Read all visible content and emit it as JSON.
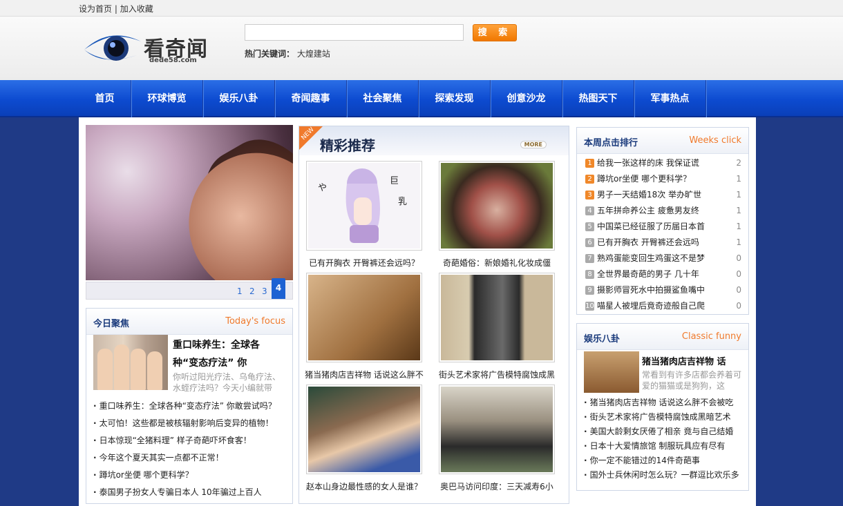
{
  "topbar": {
    "set_home": "设为首页",
    "separator": "|",
    "add_fav": "加入收藏"
  },
  "logo": {
    "brand": "看奇闻",
    "domain": "dede58.com"
  },
  "search": {
    "placeholder": "",
    "button": "搜 索",
    "hot_label": "热门关键词：",
    "hot_keyword": "大煌建站"
  },
  "nav": {
    "items": [
      "首页",
      "环球博览",
      "娱乐八卦",
      "奇闻趣事",
      "社会聚焦",
      "探索发现",
      "创意沙龙",
      "热图天下",
      "军事热点"
    ]
  },
  "slider": {
    "pages": [
      "1",
      "2",
      "3",
      "4"
    ],
    "active_page": "4"
  },
  "focus": {
    "title": "今日聚焦",
    "subtitle": "Today's focus",
    "headline": "重口味养生：全球各种“变态疗法” 你",
    "desc": "你听过阳光疗法、乌龟疗法、水蛭疗法吗？今天小编就带",
    "items": [
      "重口味养生：全球各种“变态疗法” 你敢尝试吗？",
      "太可怕！这些都是被核辐射影响后变异的植物！",
      "日本惊现“全猪料理” 样子奇葩吓坏食客！",
      "今年这个夏天其实一点都不正常！",
      "蹲坑or坐便 哪个更科学？",
      "泰国男子扮女人专骗日本人 10年骗过上百人"
    ]
  },
  "recommend": {
    "badge": "NEW",
    "title": "精彩推荐",
    "more": "MORE",
    "items": [
      {
        "caption": "已有开胸衣 开臀裤还会远吗？"
      },
      {
        "caption": "奇葩婚俗：新娘婚礼化妆成僵"
      },
      {
        "caption": "猪当猪肉店吉祥物 话说这么胖不"
      },
      {
        "caption": "街头艺术家将广告模特腐蚀成黑"
      },
      {
        "caption": "赵本山身边最性感的女人是谁？"
      },
      {
        "caption": "奥巴马访问印度：三天减寿6小"
      }
    ]
  },
  "rank": {
    "title": "本周点击排行",
    "subtitle": "Weeks click",
    "items": [
      {
        "n": "1",
        "text": "给我一张这样的床 我保证谎",
        "count": "2"
      },
      {
        "n": "2",
        "text": "蹲坑or坐便 哪个更科学？",
        "count": "1"
      },
      {
        "n": "3",
        "text": "男子一天结婚18次 举办旷世",
        "count": "1"
      },
      {
        "n": "4",
        "text": "五年拼命养公主 疲惫男友终",
        "count": "1"
      },
      {
        "n": "5",
        "text": "中国菜已经征服了历届日本首",
        "count": "1"
      },
      {
        "n": "6",
        "text": "已有开胸衣 开臀裤还会远吗",
        "count": "1"
      },
      {
        "n": "7",
        "text": "熟鸡蛋能变回生鸡蛋这不是梦",
        "count": "0"
      },
      {
        "n": "8",
        "text": "全世界最奇葩的男子 几十年",
        "count": "0"
      },
      {
        "n": "9",
        "text": "摄影师冒死水中拍摄鲨鱼嘴中",
        "count": "0"
      },
      {
        "n": "10",
        "text": "喵星人被埋后竟奇迹般自己爬",
        "count": "0"
      }
    ]
  },
  "entertainment": {
    "title": "娱乐八卦",
    "subtitle": "Classic funny",
    "headline": "猪当猪肉店吉祥物 话",
    "desc": "常看到有许多店都会养着可爱的猫猫或是狗狗，这",
    "items": [
      "猪当猪肉店吉祥物 话说这么胖不会被吃",
      "街头艺术家将广告模特腐蚀成黑暗艺术",
      "美国大龄剩女厌倦了相亲 竟与自己结婚",
      "日本十大爱情旅馆 制服玩具应有尽有",
      "你一定不能错过的14件奇葩事",
      "国外士兵休闲时怎么玩？一群逗比欢乐多"
    ]
  }
}
